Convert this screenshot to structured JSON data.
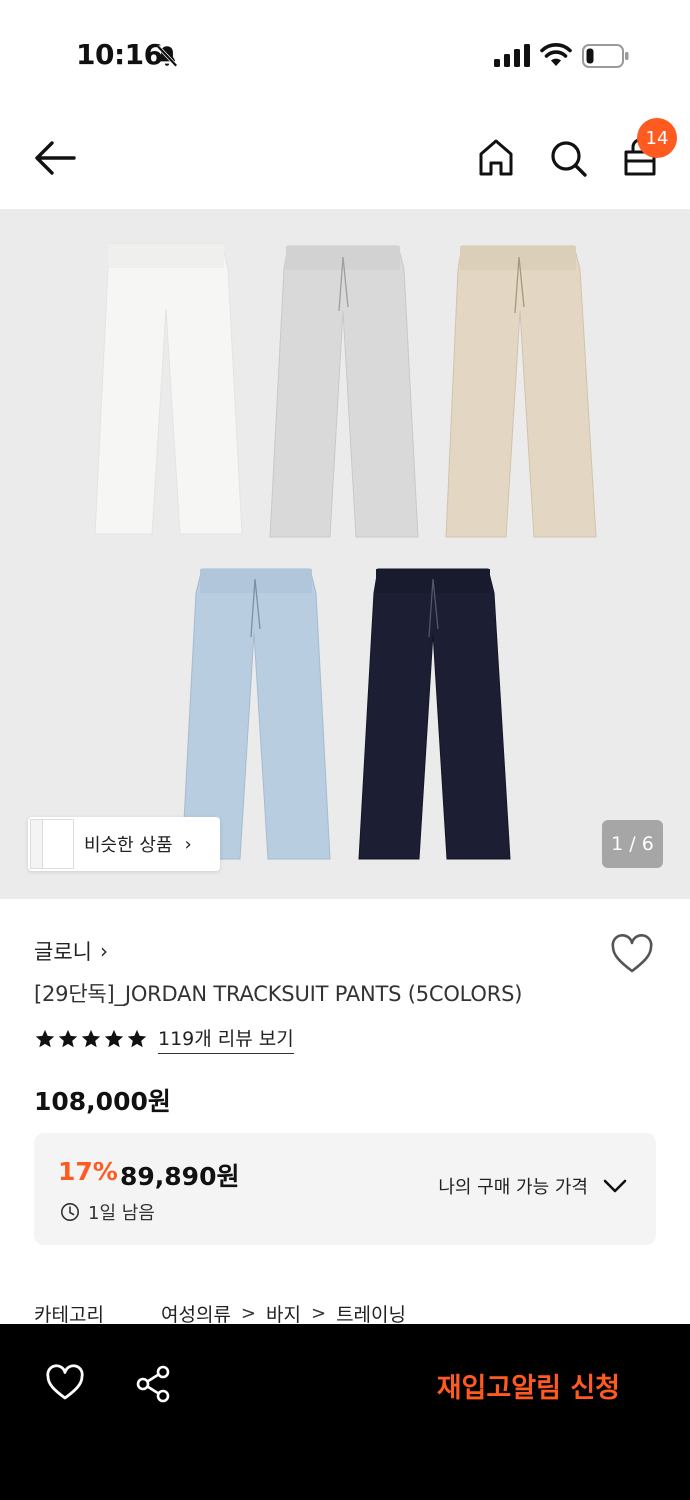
{
  "status_bar": {
    "time": "10:16"
  },
  "header": {
    "cart_count": "14"
  },
  "gallery": {
    "similar_label": "비슷한 상품",
    "page_indicator": "1 / 6",
    "colors": [
      "#f5f5f3",
      "#d9d9d9",
      "#e3d7c3",
      "#b9cde1",
      "#1c1f33"
    ]
  },
  "product": {
    "brand": "글로니",
    "name": "[29단독]_JORDAN TRACKSUIT PANTS (5COLORS)",
    "rating_stars": 5,
    "review_link": "119개 리뷰 보기",
    "original_price": "108,000원",
    "discount_percent": "17%",
    "sale_price": "89,890원",
    "time_remaining": "1일 남음",
    "my_price_label": "나의 구매 가능 가격"
  },
  "category": {
    "label": "카테고리",
    "path": [
      "여성의류",
      "바지",
      "트레이닝"
    ]
  },
  "bottom_bar": {
    "restock_label": "재입고알림 신청"
  },
  "colors": {
    "accent": "#ff5a1f",
    "price_box_bg": "#f4f4f4",
    "gallery_bg": "#ebebeb"
  }
}
